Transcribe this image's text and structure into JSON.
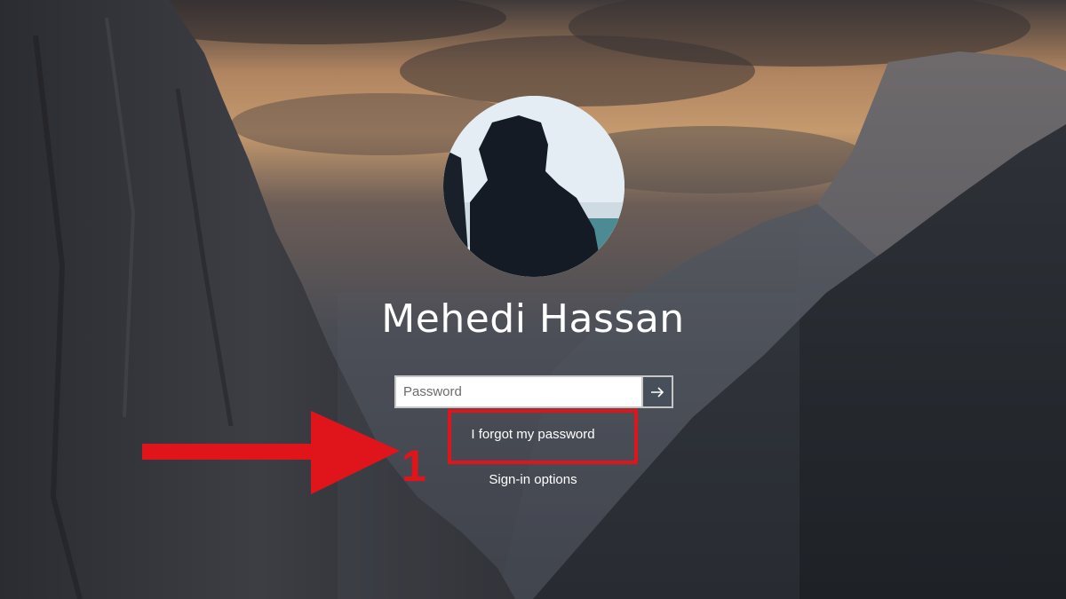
{
  "user": {
    "name": "Mehedi Hassan"
  },
  "password_field": {
    "placeholder": "Password",
    "value": ""
  },
  "submit_button": {
    "icon": "arrow-right-icon"
  },
  "links": {
    "forgot_password": "I forgot my password",
    "sign_in_options": "Sign-in options"
  },
  "annotation": {
    "step_number": "1",
    "color": "#e0151b"
  }
}
